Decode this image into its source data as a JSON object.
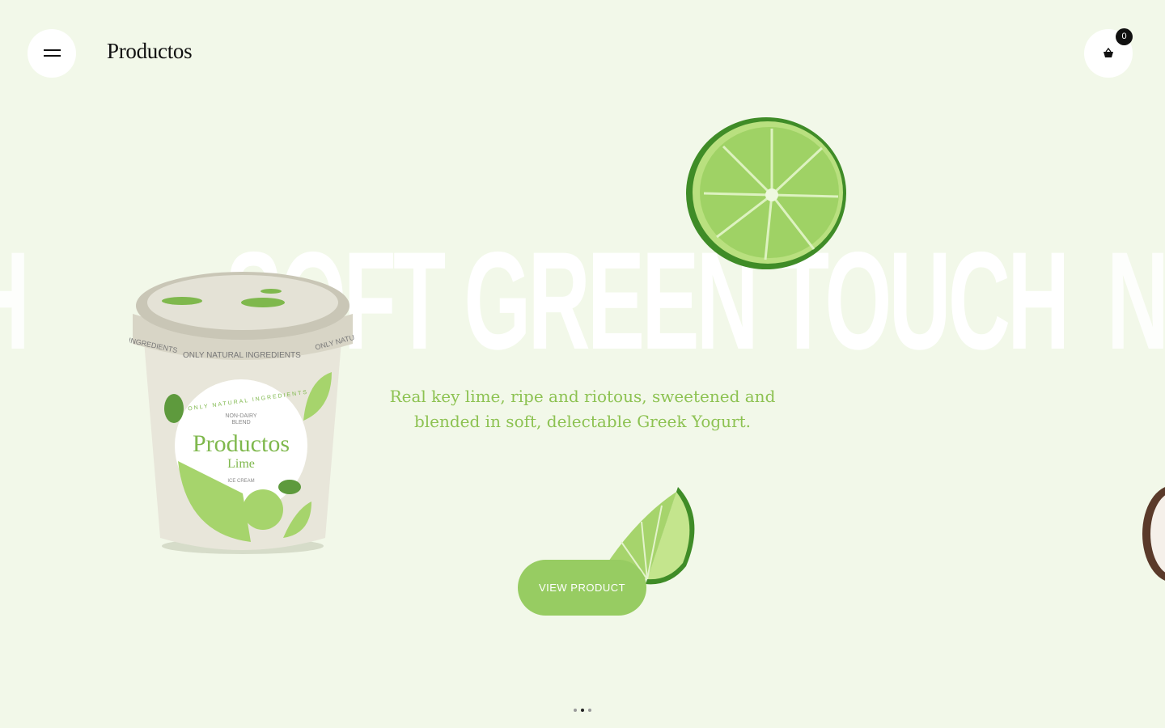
{
  "header": {
    "logo": "Productos",
    "cart_count": "0"
  },
  "hero": {
    "big_title": "SOFT GREEN TOUCH",
    "prev_fragment": "H",
    "next_fragment": "N",
    "tagline_line1": "Real key lime, ripe and riotous, sweetened and",
    "tagline_line2": "blended in soft, delectable Greek Yogurt.",
    "cta_label": "VIEW PRODUCT"
  },
  "product": {
    "band_text": "ONLY NATURAL INGREDIENTS",
    "band_left": "INGREDIENTS",
    "band_right": "ONLY NATU",
    "label_arc": "ONLY NATURAL INGREDIENTS",
    "label_blend1": "NON-DAIRY",
    "label_blend2": "BLEND",
    "label_brand": "Productos",
    "label_flavor": "Lime",
    "label_type": "ICE CREAM"
  },
  "slider": {
    "count": 3,
    "active_index": 1
  },
  "colors": {
    "background": "#f2f8e9",
    "accent_green": "#97cc62",
    "tagline_green": "#8dc252"
  }
}
